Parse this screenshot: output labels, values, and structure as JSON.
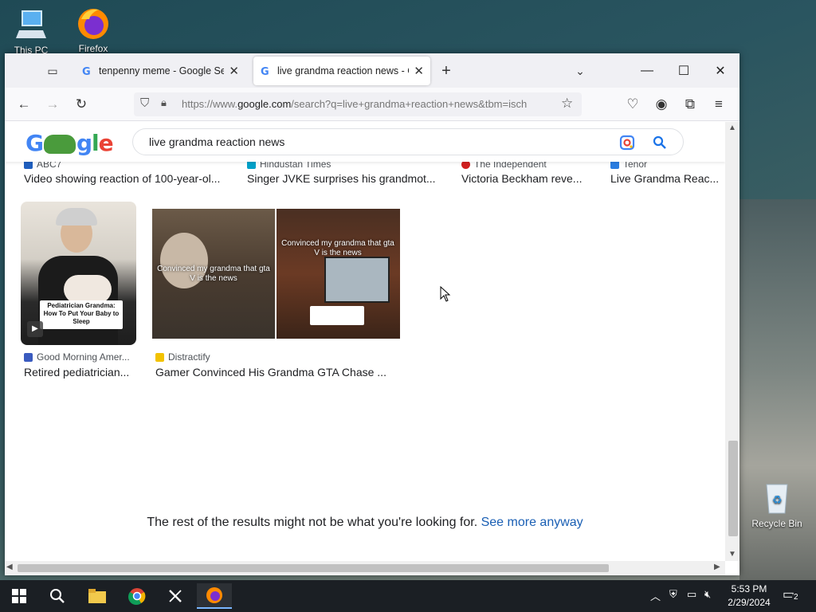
{
  "desktop": {
    "icons": [
      {
        "label": "This PC"
      },
      {
        "label": "Firefox"
      },
      {
        "label": "Recycle Bin"
      }
    ]
  },
  "browser": {
    "tabs": [
      {
        "title": "tenpenny meme - Google Search",
        "active": false
      },
      {
        "title": "live grandma reaction news - Google Search",
        "active": true
      }
    ],
    "url_prefix": "https://www.",
    "url_domain": "google.com",
    "url_rest": "/search?q=live+grandma+reaction+news&tbm=isch"
  },
  "search": {
    "logo": "Google",
    "query": "live grandma reaction news"
  },
  "results_top_row": [
    {
      "source": "ABC7",
      "title": "Video showing reaction of 100-year-ol...",
      "fav_color": "#1f5fbf"
    },
    {
      "source": "Hindustan Times",
      "title": "Singer JVKE surprises his grandmot...",
      "fav_color": "#00a0c8"
    },
    {
      "source": "The Independent",
      "title": "Victoria Beckham reve...",
      "fav_color": "#d02020"
    },
    {
      "source": "Tenor",
      "title": "Live Grandma Reac...",
      "fav_color": "#2a7de1"
    }
  ],
  "results_second_row": [
    {
      "source": "Good Morning Amer...",
      "title": "Retired pediatrician...",
      "fav_color": "#3a5bbf",
      "thumb_caption": "Pediatrician Grandma: How To Put Your Baby to Sleep"
    },
    {
      "source": "Distractify",
      "title": "Gamer Convinced His Grandma GTA Chase ...",
      "fav_color": "#f2c200",
      "thumb_caption_left": "Convinced my grandma that gta V is the news",
      "thumb_caption_right": "Convinced my grandma that gta V is the news"
    }
  ],
  "footer_note": {
    "text": "The rest of the results might not be what you're looking for.",
    "link": "See more anyway"
  },
  "taskbar": {
    "time": "5:53 PM",
    "date": "2/29/2024",
    "notification_count": "2"
  }
}
